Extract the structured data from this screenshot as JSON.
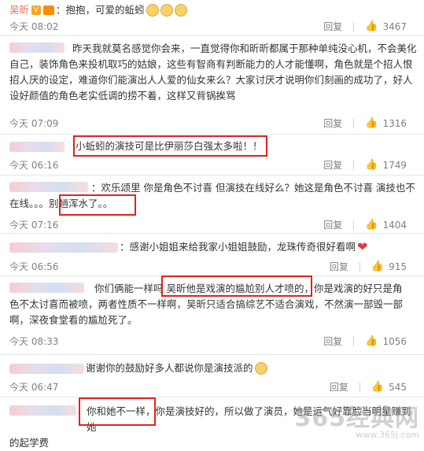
{
  "comments": [
    {
      "user": "吴昕",
      "text": "抱抱，可爱的蚯蚓",
      "time": "今天 08:02",
      "reply": "回复",
      "likes": "3467"
    },
    {
      "text_lines": [
        "昨天我就莫名感觉你会来，一直觉得你和昕昕都属于那种单纯没心机，不会美化",
        "自己，装饰角色来投机取巧的姑娘，这些有智商有判断能力的人才能懂啊，角色就是个招人恨",
        "招人厌的设定，难道你们能演出人人爱的仙女来么？大家讨厌才说明你们刻画的成功了，好人",
        "设好颜值的角色老实低调的捞不着，这样又背锅挨骂"
      ],
      "time": "今天 07:09",
      "reply": "回复",
      "likes": "1316"
    },
    {
      "text": "小蚯蚓的演技可是比伊丽莎白强太多啦！！",
      "time": "今天 06:16",
      "reply": "回复",
      "likes": "1749"
    },
    {
      "text_lines": [
        "：欢乐颂里 你是角色不讨喜 但演技在线好么？她这是角色不讨喜 演技也不",
        "在线。。。别趟浑水了。。"
      ],
      "time": "今天 07:16",
      "reply": "回复",
      "likes": "1404"
    },
    {
      "text": "：感谢小姐姐来给我家小姐姐鼓励，龙珠传奇很好看啊",
      "time": "今天 06:56",
      "reply": "回复",
      "likes": "915"
    },
    {
      "text_lines": [
        "你们俩能一样吗 吴昕他是戏演的尴尬别人才喷的，你是戏演的好只是角",
        "色不太讨喜而被喷，两者性质不一样啊，吴昕只适合搞综艺不适合演戏，不然演一部毁一部",
        "啊，深夜食堂看的尴尬死了。"
      ],
      "time": "今天 08:33",
      "reply": "回复",
      "likes": "1056"
    },
    {
      "text": "谢谢你的鼓励好多人都说你是演技派的",
      "time": "今天 06:47",
      "reply": "回复",
      "likes": "545"
    },
    {
      "text_lines": [
        "你和她不一样，你是演技好的，所以做了演员，她是运气好靠脸当明星赚到她",
        "的起学费"
      ]
    }
  ],
  "watermark": {
    "main": "365经典网",
    "sub": "www.365j.com"
  },
  "colors": {
    "username": "#eb7350",
    "highlight": "#e0231b",
    "meta": "#808080"
  }
}
